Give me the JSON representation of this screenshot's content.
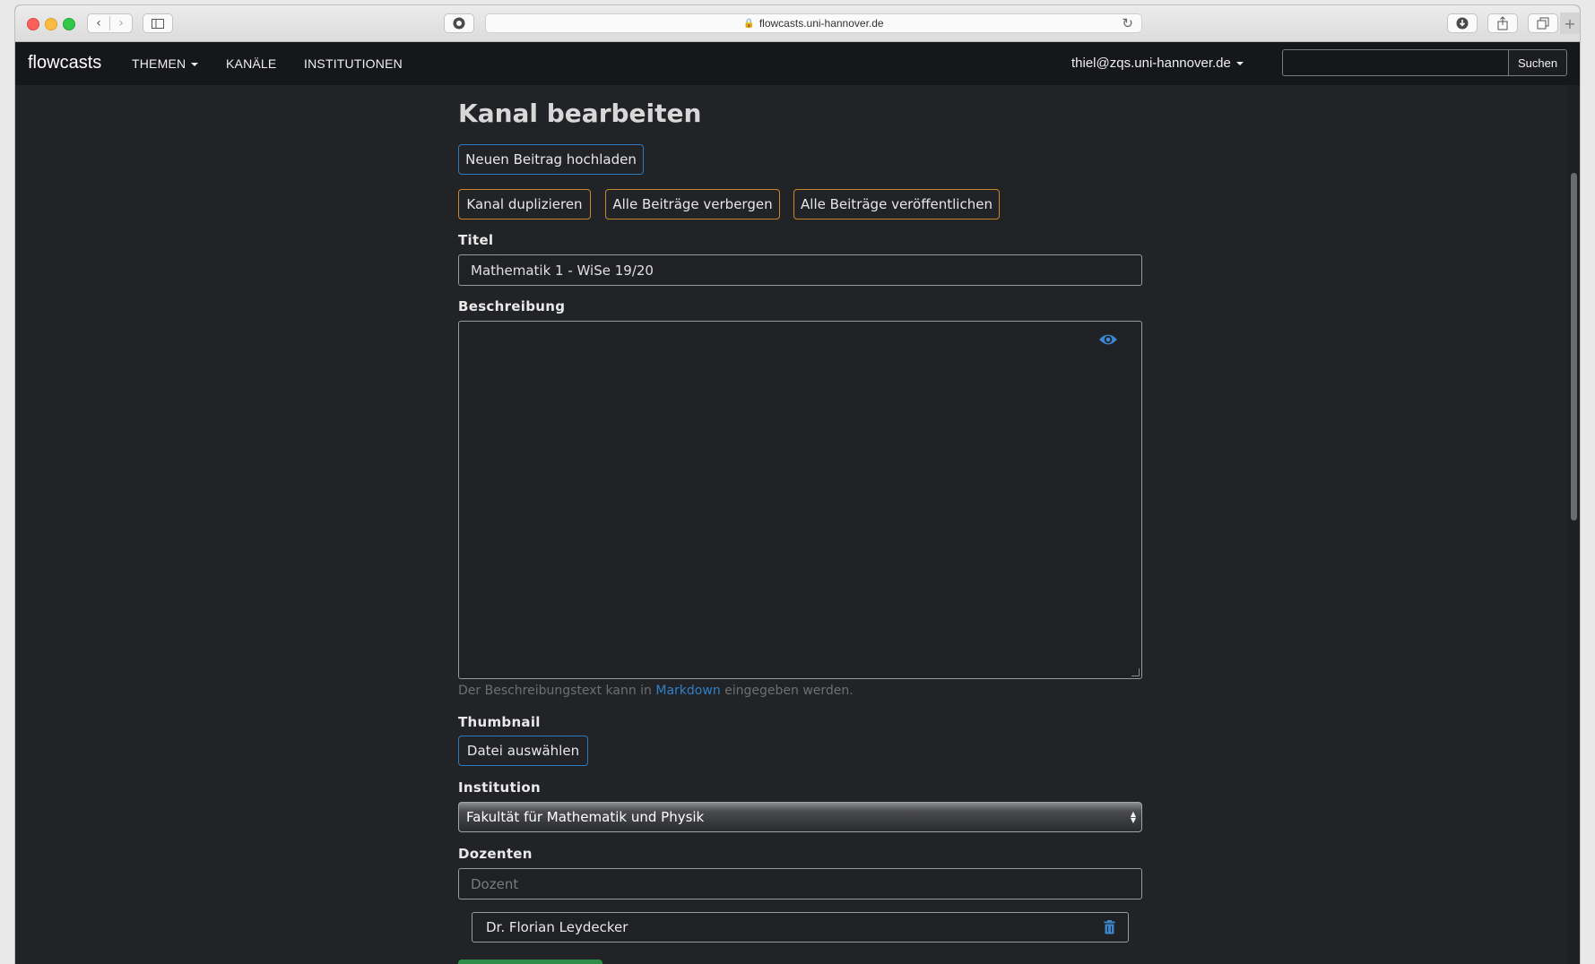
{
  "browser": {
    "url": "flowcasts.uni-hannover.de"
  },
  "navbar": {
    "brand": "flowcasts",
    "links": [
      {
        "label": "THEMEN"
      },
      {
        "label": "KANÄLE"
      },
      {
        "label": "INSTITUTIONEN"
      }
    ],
    "user": "thiel@zqs.uni-hannover.de",
    "search": {
      "value": "",
      "button": "Suchen"
    }
  },
  "page": {
    "title": "Kanal bearbeiten",
    "upload_button": "Neuen Beitrag hochladen",
    "actions": [
      {
        "label": "Kanal duplizieren"
      },
      {
        "label": "Alle Beiträge verbergen"
      },
      {
        "label": "Alle Beiträge veröffentlichen"
      }
    ]
  },
  "form": {
    "title_label": "Titel",
    "title_value": "Mathematik 1 - WiSe 19/20",
    "description_label": "Beschreibung",
    "description_value": "",
    "description_help_prefix": "Der Beschreibungstext kann in",
    "description_help_link": "Markdown",
    "description_help_suffix": "eingegeben werden.",
    "thumbnail_label": "Thumbnail",
    "thumbnail_button": "Datei auswählen",
    "institution_label": "Institution",
    "institution_value": "Fakultät für Mathematik und Physik",
    "lecturers_label": "Dozenten",
    "lecturer_placeholder": "Dozent",
    "lecturers": [
      "Dr. Florian Leydecker"
    ]
  },
  "colors": {
    "background": "#222326",
    "navbar": "#16171a",
    "primary_outline": "#2d7bbd",
    "warning_outline": "#c8892c",
    "link": "#2f80c9",
    "success": "#2f8f4a"
  }
}
